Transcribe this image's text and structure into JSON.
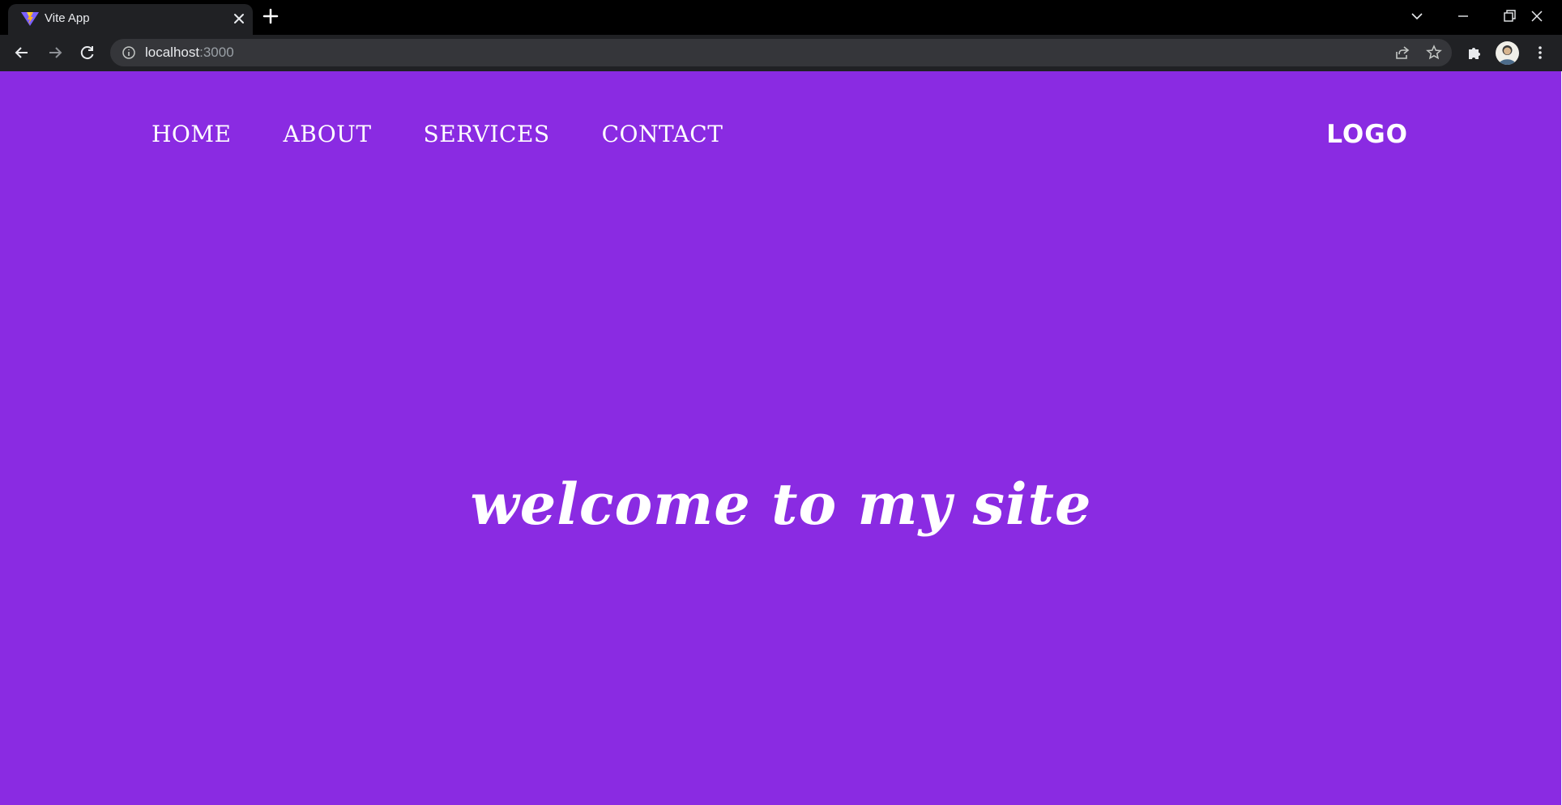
{
  "browser": {
    "tab_title": "Vite App",
    "url_host": "localhost",
    "url_port": ":3000",
    "icons": {
      "favicon": "vite-favicon",
      "tab_close": "close-icon",
      "new_tab": "plus-icon",
      "tab_search": "chevron-down-icon",
      "minimize": "minimize-icon",
      "restore": "restore-icon",
      "close_window": "close-icon",
      "back": "arrow-left-icon",
      "forward": "arrow-right-icon",
      "reload": "reload-icon",
      "site_info": "info-icon",
      "share": "share-icon",
      "bookmark": "star-icon",
      "extensions": "puzzle-icon",
      "profile": "avatar",
      "menu": "kebab-menu-icon"
    }
  },
  "site": {
    "nav": [
      "HOME",
      "ABOUT",
      "SERVICES",
      "CONTACT"
    ],
    "logo": "LOGO",
    "headline": "welcome to my site",
    "background_color": "#8a2be2",
    "text_color": "#ffffff"
  }
}
